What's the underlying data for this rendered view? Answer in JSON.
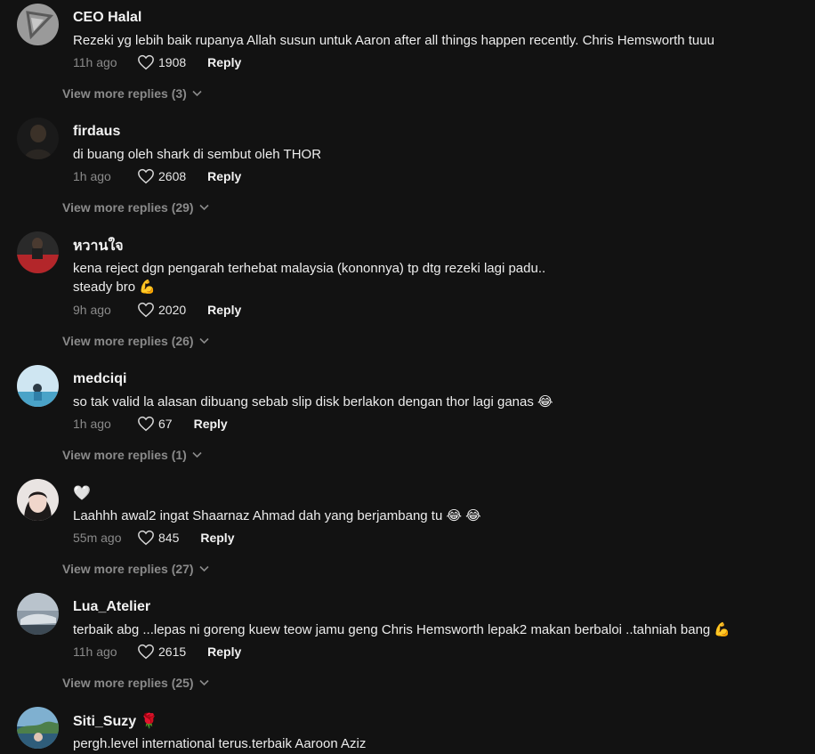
{
  "comments": [
    {
      "username": "CEO Halal",
      "text_lines": [
        "Rezeki yg lebih baik rupanya Allah susun untuk Aaron after all things happen recently. Chris Hemsworth tuuu"
      ],
      "time": "11h ago",
      "likes": "1908",
      "reply_label": "Reply",
      "view_more": "View more replies (3)"
    },
    {
      "username": "firdaus",
      "text_lines": [
        "di buang oleh shark di sembut oleh THOR"
      ],
      "time": "1h ago",
      "likes": "2608",
      "reply_label": "Reply",
      "view_more": "View more replies (29)"
    },
    {
      "username": "หวานใจ",
      "text_lines": [
        "kena reject dgn pengarah terhebat malaysia (kononnya) tp dtg rezeki lagi padu..",
        "steady bro 💪"
      ],
      "time": "9h ago",
      "likes": "2020",
      "reply_label": "Reply",
      "view_more": "View more replies (26)"
    },
    {
      "username": "medciqi",
      "text_lines": [
        "so tak valid la alasan dibuang sebab slip disk berlakon dengan thor lagi ganas 😂"
      ],
      "time": "1h ago",
      "likes": "67",
      "reply_label": "Reply",
      "view_more": "View more replies (1)"
    },
    {
      "username": "🤍",
      "text_lines": [
        "Laahhh awal2 ingat Shaarnaz Ahmad dah yang berjambang tu 😂 😂"
      ],
      "time": "55m ago",
      "likes": "845",
      "reply_label": "Reply",
      "view_more": "View more replies (27)"
    },
    {
      "username": "Lua_Atelier",
      "text_lines": [
        "terbaik abg ...lepas ni goreng kuew teow jamu geng Chris Hemsworth lepak2 makan berbaloi ..tahniah bang 💪"
      ],
      "time": "11h ago",
      "likes": "2615",
      "reply_label": "Reply",
      "view_more": "View more replies (25)"
    },
    {
      "username": "Siti_Suzy 🌹",
      "text_lines": [
        "pergh.level international terus.terbaik Aaroon Aziz"
      ]
    }
  ]
}
